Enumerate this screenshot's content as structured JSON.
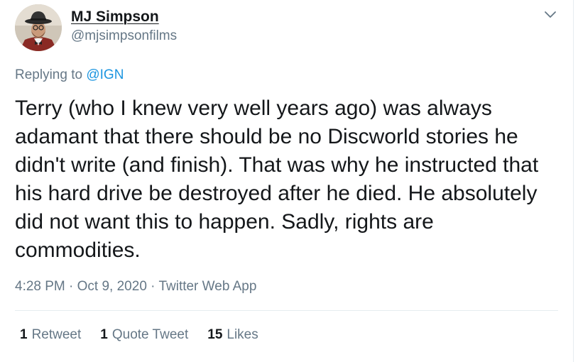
{
  "user": {
    "display_name": "MJ Simpson",
    "handle": "@mjsimpsonfilms"
  },
  "reply": {
    "prefix": "Replying to ",
    "mention": "@IGN"
  },
  "tweet": {
    "text": "Terry (who I knew very well years ago) was always\nadamant that there should be no Discworld stories he\ndidn't write (and finish). That was why he instructed that\nhis hard drive be destroyed after he died. He absolutely\ndid not want this to happen. Sadly, rights are\ncommodities."
  },
  "meta": {
    "time": "4:28 PM",
    "separator": "·",
    "date": "Oct 9, 2020",
    "source": "Twitter Web App"
  },
  "stats": {
    "retweets": {
      "count": "1",
      "label": "Retweet"
    },
    "quotes": {
      "count": "1",
      "label": "Quote Tweet"
    },
    "likes": {
      "count": "15",
      "label": "Likes"
    }
  },
  "colors": {
    "text": "#14171a",
    "secondary": "#657786",
    "link": "#1b95e0",
    "border": "#e6ecf0"
  },
  "icons": {
    "caret": "chevron-down-icon",
    "avatar": "profile-photo"
  }
}
